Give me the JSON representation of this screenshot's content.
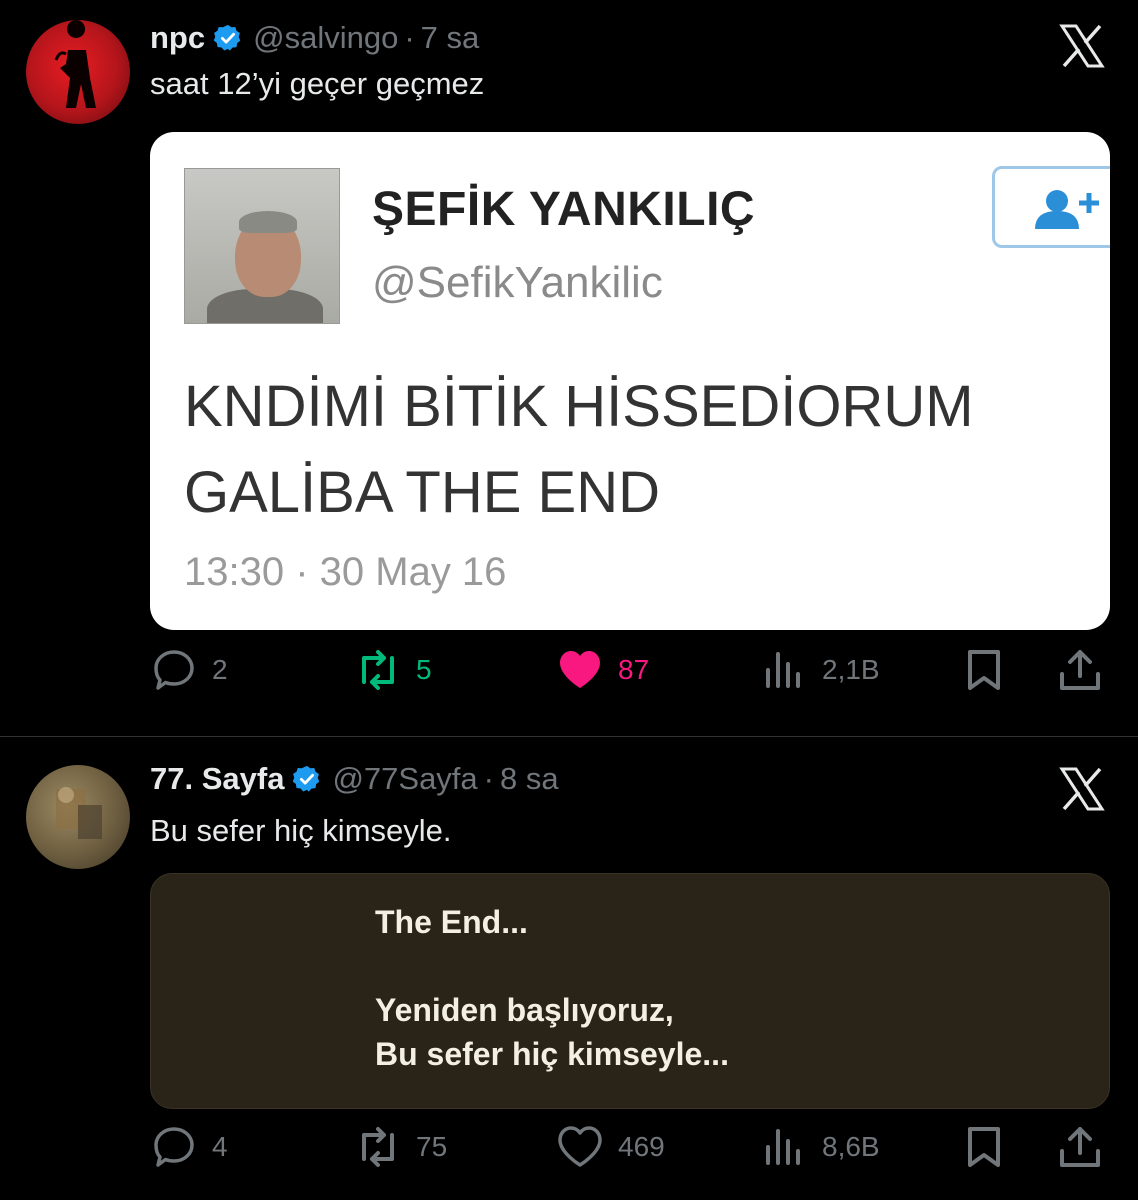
{
  "posts": [
    {
      "display_name": "npc",
      "handle": "@salvingo",
      "separator": "·",
      "time": "7 sa",
      "text": "saat 12’yi geçer geçmez",
      "quoted": {
        "name": "ŞEFİK YANKILIÇ",
        "handle": "@SefikYankilic",
        "body_line1": "KNDİMİ BİTİK HİSSEDİORUM",
        "body_line2": "GALİBA THE END",
        "timestamp": "13:30 · 30 May 16"
      },
      "stats": {
        "replies": "2",
        "reposts": "5",
        "likes": "87",
        "views": "2,1B"
      },
      "state": {
        "reposted": true,
        "liked": true
      }
    },
    {
      "display_name": "77. Sayfa",
      "handle": "@77Sayfa",
      "separator": "·",
      "time": "8 sa",
      "text": "Bu sefer hiç kimseyle.",
      "quoted": {
        "line1": "The End...",
        "line2": "Yeniden başlıyoruz,",
        "line3": "Bu sefer hiç kimseyle..."
      },
      "stats": {
        "replies": "4",
        "reposts": "75",
        "likes": "469",
        "views": "8,6B"
      },
      "state": {
        "reposted": false,
        "liked": false
      }
    }
  ],
  "colors": {
    "background": "#000000",
    "text_primary": "#e7e9ea",
    "text_secondary": "#71767b",
    "verified": "#1d9bf0",
    "repost_active": "#00ba7c",
    "like_active": "#f91880"
  },
  "icons": [
    "verified-badge-icon",
    "x-logo-icon",
    "reply-icon",
    "repost-icon",
    "heart-icon",
    "views-icon",
    "bookmark-icon",
    "share-icon",
    "follow-user-icon"
  ]
}
